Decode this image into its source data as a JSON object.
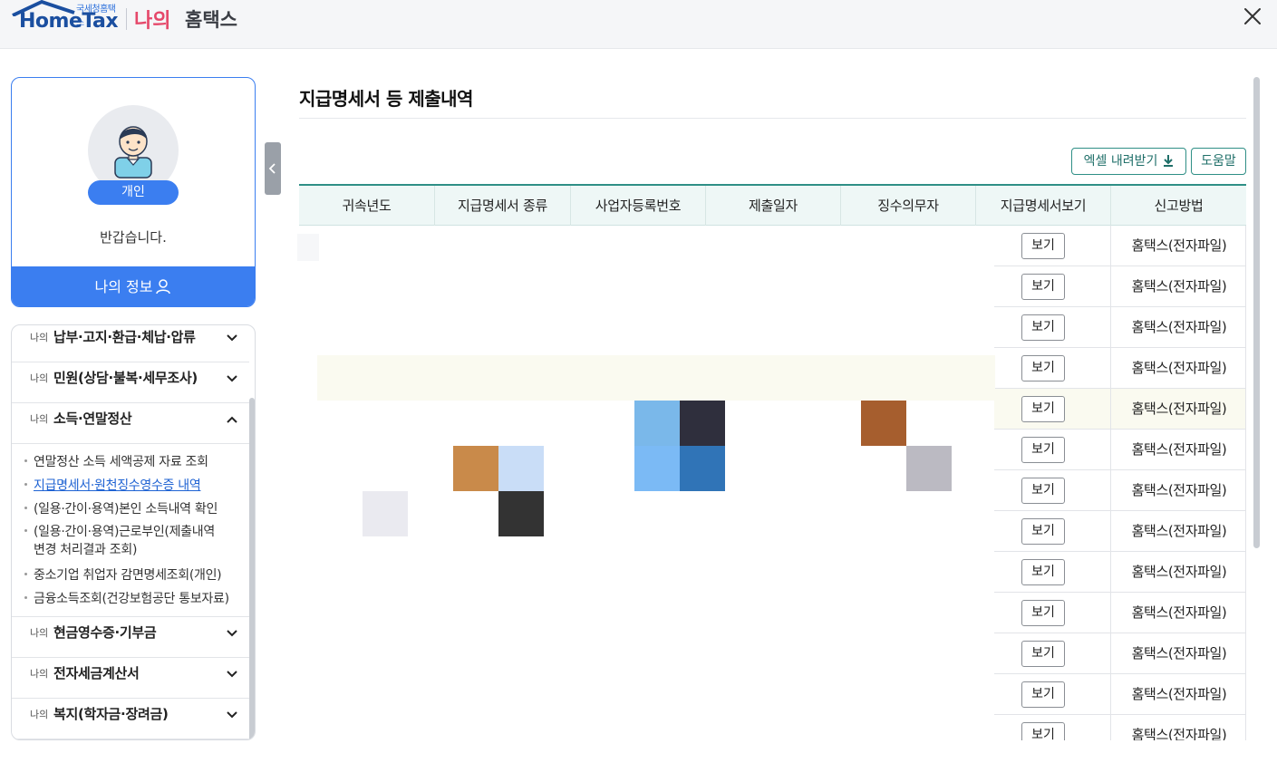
{
  "header": {
    "logo_ko": "국세청홈택스",
    "logo_en": "HomeTax",
    "brand_highlight": "나의",
    "brand_rest": "홈택스"
  },
  "profile": {
    "badge": "개인",
    "greeting": "반갑습니다.",
    "my_info_button": "나의 정보"
  },
  "menu": {
    "prefix": "나의",
    "sections": [
      {
        "title": "납부·고지·환급·체납·압류",
        "expanded": false
      },
      {
        "title": "민원(상담·불복·세무조사)",
        "expanded": false
      },
      {
        "title": "소득·연말정산",
        "expanded": true
      },
      {
        "title": "현금영수증·기부금",
        "expanded": false
      },
      {
        "title": "전자세금계산서",
        "expanded": false
      },
      {
        "title": "복지(학자금·장려금)",
        "expanded": false
      }
    ],
    "submenu": [
      {
        "label": "연말정산 소득 세액공제 자료 조회",
        "active": false
      },
      {
        "label": "지급명세서·원천징수영수증 내역",
        "active": true
      },
      {
        "label": "(일용·간이·용역)본인 소득내역 확인",
        "active": false
      },
      {
        "label": "(일용·간이·용역)근로부인(제출내역",
        "label2": "변경 처리결과 조회)",
        "active": false
      },
      {
        "label": "중소기업 취업자 감면명세조회(개인)",
        "active": false
      },
      {
        "label": "금융소득조회(건강보험공단 통보자료)",
        "active": false
      }
    ]
  },
  "main": {
    "title": "지급명세서 등 제출내역",
    "excel_button": "엑셀 내려받기",
    "help_button": "도움말",
    "table": {
      "headers": [
        "귀속년도",
        "지급명세서 종류",
        "사업자등록번호",
        "제출일자",
        "징수의무자",
        "지급명세서보기",
        "신고방법"
      ],
      "view_label": "보기",
      "rows": [
        {
          "method": "홈택스(전자파일)"
        },
        {
          "method": "홈택스(전자파일)"
        },
        {
          "method": "홈택스(전자파일)"
        },
        {
          "method": "홈택스(전자파일)"
        },
        {
          "method": "홈택스(전자파일)",
          "highlight": true
        },
        {
          "method": "홈택스(전자파일)"
        },
        {
          "method": "홈택스(전자파일)"
        },
        {
          "method": "홈택스(전자파일)"
        },
        {
          "method": "홈택스(전자파일)"
        },
        {
          "method": "홈택스(전자파일)"
        },
        {
          "method": "홈택스(전자파일)"
        },
        {
          "method": "홈택스(전자파일)"
        },
        {
          "method": "홈택스(전자파일)"
        }
      ]
    }
  },
  "colors": {
    "accent_blue": "#3b7ef0",
    "teal": "#2f8f86",
    "brand_pink": "#e5486a",
    "redaction_tiles": [
      "#c98a4a",
      "#c9ddf7",
      "#333333",
      "#eaeaf0",
      "#7ab8ea",
      "#2f2f3d",
      "#7bbaf5",
      "#3074b7",
      "#a65e2e",
      "#bbbac2"
    ]
  }
}
